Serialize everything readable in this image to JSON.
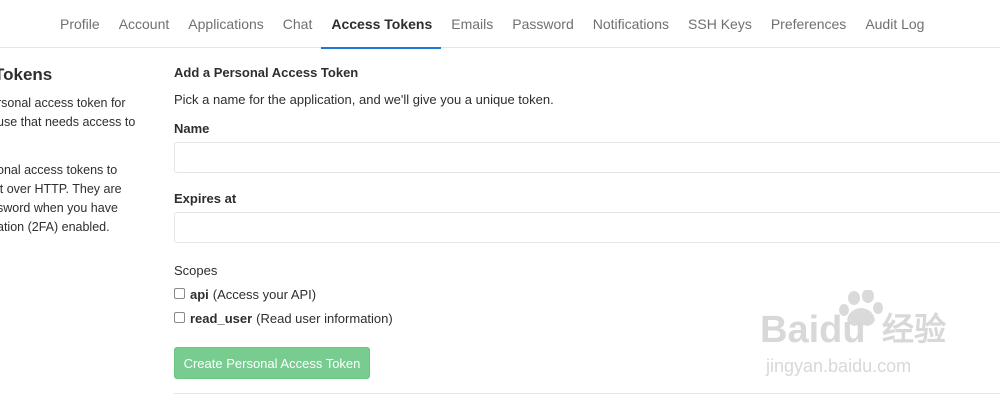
{
  "nav": {
    "tabs": [
      {
        "label": "Profile"
      },
      {
        "label": "Account"
      },
      {
        "label": "Applications"
      },
      {
        "label": "Chat"
      },
      {
        "label": "Access Tokens"
      },
      {
        "label": "Emails"
      },
      {
        "label": "Password"
      },
      {
        "label": "Notifications"
      },
      {
        "label": "SSH Keys"
      },
      {
        "label": "Preferences"
      },
      {
        "label": "Audit Log"
      }
    ],
    "active_tab": "Access Tokens"
  },
  "sidebar": {
    "heading": "Tokens",
    "lines": [
      "rsonal access token for",
      "use that needs access to",
      "onal access tokens to",
      "it over HTTP. They are",
      "sword when you have",
      "ation (2FA) enabled."
    ]
  },
  "form": {
    "heading": "Add a Personal Access Token",
    "description": "Pick a name for the application, and we'll give you a unique token.",
    "name_label": "Name",
    "name_value": "",
    "expires_label": "Expires at",
    "expires_value": "",
    "scopes_label": "Scopes",
    "scopes": [
      {
        "name": "api",
        "description": "(Access your API)",
        "checked": false
      },
      {
        "name": "read_user",
        "description": "(Read user information)",
        "checked": false
      }
    ],
    "submit_label": "Create Personal Access Token"
  },
  "watermark": {
    "brand": "Baidu",
    "text_cn": "经验",
    "url": "jingyan.baidu.com"
  },
  "colors": {
    "accent": "#1f78d1",
    "button_bg": "#78cc8f",
    "border": "#e5e5e5"
  }
}
